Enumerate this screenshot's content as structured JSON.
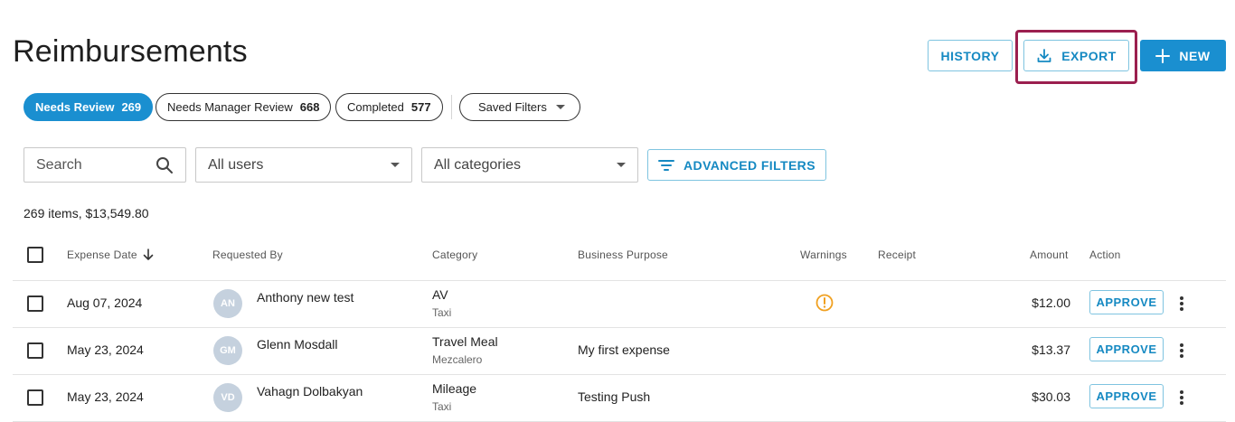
{
  "page": {
    "title": "Reimbursements"
  },
  "header": {
    "history_label": "HISTORY",
    "export_label": "EXPORT",
    "new_label": "NEW"
  },
  "tabs": [
    {
      "label": "Needs Review",
      "count": "269",
      "active": true
    },
    {
      "label": "Needs Manager Review",
      "count": "668",
      "active": false
    },
    {
      "label": "Completed",
      "count": "577",
      "active": false
    }
  ],
  "saved_filters_label": "Saved Filters",
  "filters": {
    "search_placeholder": "Search",
    "users_value": "All users",
    "categories_value": "All categories",
    "advanced_label": "ADVANCED FILTERS"
  },
  "summary": "269 items, $13,549.80",
  "columns": {
    "expense_date": "Expense Date",
    "requested_by": "Requested By",
    "category": "Category",
    "business_purpose": "Business Purpose",
    "warnings": "Warnings",
    "receipt": "Receipt",
    "amount": "Amount",
    "action": "Action"
  },
  "rows": [
    {
      "date": "Aug 07, 2024",
      "initials": "AN",
      "requester": "Anthony new test",
      "category": "AV",
      "subcategory": "Taxi",
      "purpose": "",
      "has_warning": true,
      "amount": "$12.00",
      "action": "APPROVE"
    },
    {
      "date": "May 23, 2024",
      "initials": "GM",
      "requester": "Glenn Mosdall",
      "category": "Travel Meal",
      "subcategory": "Mezcalero",
      "purpose": "My first expense",
      "has_warning": false,
      "amount": "$13.37",
      "action": "APPROVE"
    },
    {
      "date": "May 23, 2024",
      "initials": "VD",
      "requester": "Vahagn Dolbakyan",
      "category": "Mileage",
      "subcategory": "Taxi",
      "purpose": "Testing Push",
      "has_warning": false,
      "amount": "$30.03",
      "action": "APPROVE"
    }
  ],
  "colors": {
    "accent": "#1a8fd0",
    "highlight": "#9b1f4f",
    "warning": "#f0a020"
  }
}
